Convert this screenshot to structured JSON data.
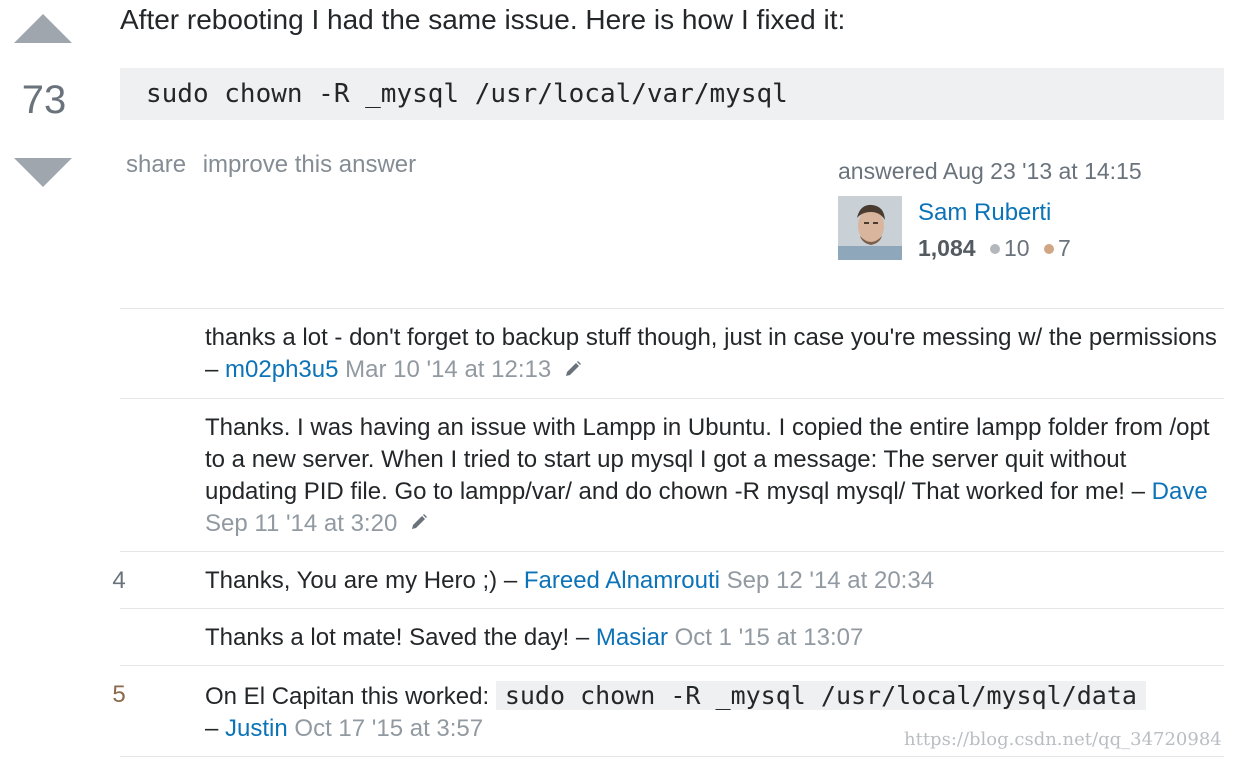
{
  "answer": {
    "vote_count": "73",
    "text": "After rebooting I had the same issue. Here is how I fixed it:",
    "code": "sudo chown -R _mysql /usr/local/var/mysql",
    "menu": {
      "share": "share",
      "improve": "improve this answer"
    },
    "user_card": {
      "action_time": "answered Aug 23 '13 at 14:15",
      "name": "Sam Ruberti",
      "reputation": "1,084",
      "silver_badges": "10",
      "bronze_badges": "7",
      "silver_color": "#b4b8bc",
      "bronze_color": "#d1a684"
    }
  },
  "comments": [
    {
      "score": "",
      "text": "thanks a lot - don't forget to backup stuff though, just in case you're messing w/ the permissions",
      "dash": "–",
      "user": "m02ph3u5",
      "date": "Mar 10 '14 at 12:13",
      "edited_icon": "pencil-icon"
    },
    {
      "score": "",
      "text": "Thanks. I was having an issue with Lampp in Ubuntu. I copied the entire lampp folder from /opt to a new server. When I tried to start up mysql I got a message: The server quit without updating PID file. Go to lampp/var/ and do chown -R mysql mysql/ That worked for me!",
      "dash": "–",
      "user": "Dave",
      "date": "Sep 11 '14 at 3:20",
      "edited_icon": "pencil-icon"
    },
    {
      "score": "4",
      "text": "Thanks, You are my Hero ;)",
      "dash": "–",
      "user": "Fareed Alnamrouti",
      "date": "Sep 12 '14 at 20:34"
    },
    {
      "score": "",
      "text": "Thanks a lot mate! Saved the day!",
      "dash": "–",
      "user": "Masiar",
      "date": "Oct 1 '15 at 13:07"
    },
    {
      "score": "5",
      "text": "On El Capitan this worked:",
      "code": "sudo chown -R _mysql /usr/local/mysql/data",
      "dash": "–",
      "user": "Justin",
      "date": "Oct 17 '15 at 3:57"
    }
  ],
  "watermark": "https://blog.csdn.net/qq_34720984"
}
